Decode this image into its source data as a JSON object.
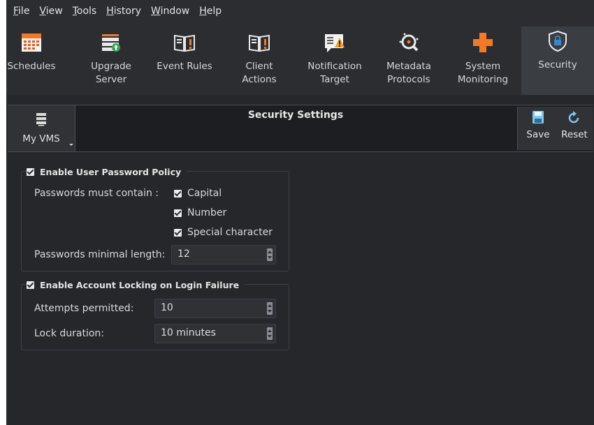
{
  "menu": [
    "File",
    "View",
    "Tools",
    "History",
    "Window",
    "Help"
  ],
  "toolbar": {
    "items": [
      {
        "line1": "Schedules",
        "line2": "",
        "icon": "calendar-icon"
      },
      {
        "line1": "Upgrade",
        "line2": "Server",
        "icon": "server-upgrade-icon"
      },
      {
        "line1": "Event Rules",
        "line2": "",
        "icon": "book-icon"
      },
      {
        "line1": "Client",
        "line2": "Actions",
        "icon": "book-icon"
      },
      {
        "line1": "Notification",
        "line2": "Target",
        "icon": "notification-warning-icon"
      },
      {
        "line1": "Metadata",
        "line2": "Protocols",
        "icon": "metadata-icon"
      },
      {
        "line1": "System",
        "line2": "Monitoring",
        "icon": "medical-cross-icon"
      },
      {
        "line1": "Security",
        "line2": "",
        "icon": "shield-lock-icon"
      }
    ],
    "active": "Security"
  },
  "header": {
    "vms_label": "My VMS",
    "title": "Security Settings",
    "save_label": "Save",
    "reset_label": "Reset"
  },
  "password_policy": {
    "title": "Enable User Password Policy",
    "checked": true,
    "contain_label": "Passwords must contain :",
    "options": [
      {
        "label": "Capital",
        "checked": true
      },
      {
        "label": "Number",
        "checked": true
      },
      {
        "label": "Special character",
        "checked": true
      }
    ],
    "min_length_label": "Passwords minimal length:",
    "min_length_value": "12"
  },
  "account_locking": {
    "title": "Enable Account Locking on Login Failure",
    "checked": true,
    "attempts_label": "Attempts permitted:",
    "attempts_value": "10",
    "duration_label": "Lock duration:",
    "duration_value": "10 minutes"
  },
  "colors": {
    "background": "#25272b",
    "toolbar": "#2b2d31",
    "active_tab": "#3a3d42",
    "save_icon": "#7fc6f0",
    "accent_orange": "#f07a2a"
  }
}
